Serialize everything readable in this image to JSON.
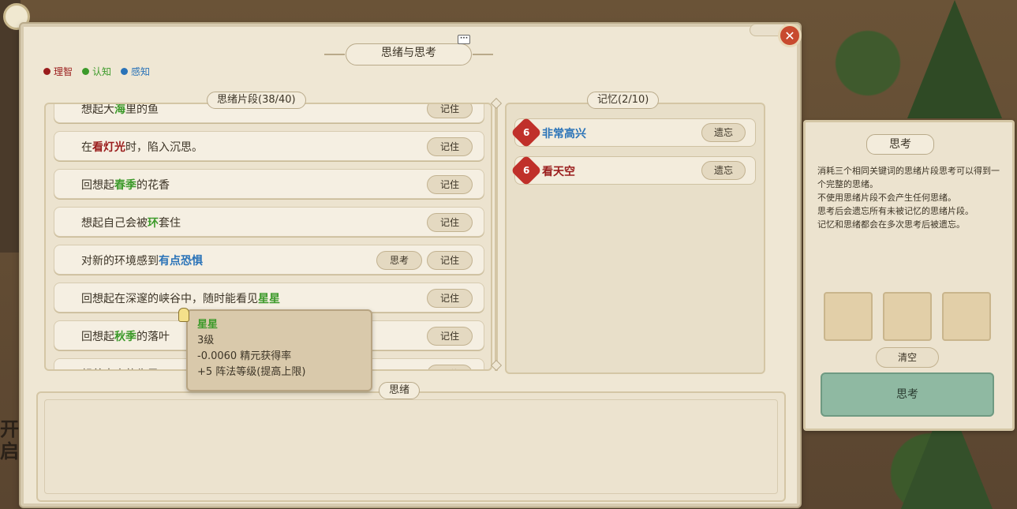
{
  "dialog": {
    "title": "思绪与思考",
    "more_label": "···",
    "close_label": "✕"
  },
  "legend": [
    {
      "label": "理智",
      "color": "#9a1c1c"
    },
    {
      "label": "认知",
      "color": "#3c9a2a"
    },
    {
      "label": "感知",
      "color": "#2a73b8"
    }
  ],
  "fragments": {
    "header": "思绪片段(38/40)",
    "remember_label": "记住",
    "think_label": "思考",
    "items": [
      {
        "pre": "想起大",
        "kw": "海",
        "kwclass": "kw-green",
        "post": "里的鱼",
        "think": false
      },
      {
        "pre": "在",
        "kw": "看灯光",
        "kwclass": "kw-red",
        "post": "时，陷入沉思。",
        "think": false
      },
      {
        "pre": "回想起",
        "kw": "春季",
        "kwclass": "kw-green",
        "post": "的花香",
        "think": false
      },
      {
        "pre": "想起自己会被",
        "kw": "环",
        "kwclass": "kw-green",
        "post": "套住",
        "think": false
      },
      {
        "pre": "对新的环境感到",
        "kw": "有点恐惧",
        "kwclass": "kw-blue",
        "post": "",
        "think": true
      },
      {
        "pre": "回想起在深邃的峡谷中，随时能看见",
        "kw": "星星",
        "kwclass": "kw-green",
        "post": "",
        "think": false
      },
      {
        "pre": "回想起",
        "kw": "秋季",
        "kwclass": "kw-green",
        "post": "的落叶",
        "think": false
      },
      {
        "pre": "想着未来的生灵，",
        "kw": "",
        "kwclass": "",
        "post": "",
        "think": false
      }
    ]
  },
  "memory": {
    "header": "记忆(2/10)",
    "forget_label": "遗忘",
    "items": [
      {
        "badge": "6",
        "label": "非常高兴",
        "color": "#2a73b8"
      },
      {
        "badge": "6",
        "label": "看天空",
        "color": "#9a1c1c"
      }
    ]
  },
  "thought": {
    "header": "思绪"
  },
  "tooltip": {
    "title": "星星",
    "level": "3级",
    "line1": "-0.0060  精元获得率",
    "line2": "+5  阵法等级(提高上限)"
  },
  "think_panel": {
    "title": "思考",
    "desc": [
      "消耗三个相同关键词的思绪片段思考可以得到一个完整的思绪。",
      "不使用思绪片段不会产生任何思绪。",
      "思考后会遗忘所有未被记忆的思绪片段。",
      "记忆和思绪都会在多次思考后被遗忘。"
    ],
    "clear_label": "清空",
    "think_button_label": "思考"
  },
  "left_edge": {
    "text": "开启"
  }
}
